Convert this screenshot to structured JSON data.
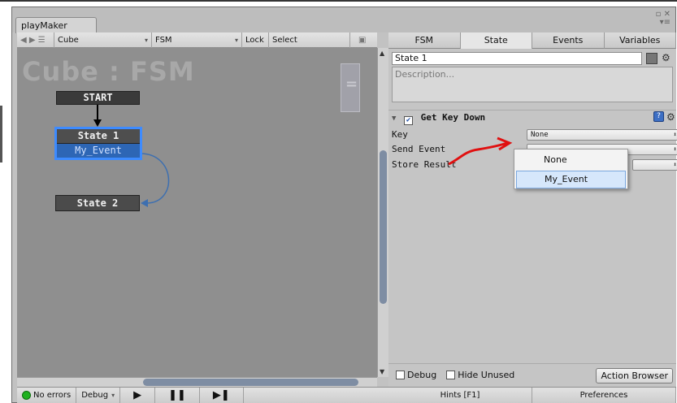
{
  "window": {
    "title": "playMaker",
    "controls": "▫ ✕"
  },
  "toolbar": {
    "object": "Cube",
    "fsm": "FSM",
    "lock": "Lock",
    "select": "Select"
  },
  "canvas": {
    "title": "Cube : FSM",
    "nodes": {
      "start": "START",
      "state1": "State 1",
      "state1_event": "My_Event",
      "state2": "State 2"
    }
  },
  "statusbar": {
    "errors": "No errors",
    "debug": "Debug",
    "play": "▶",
    "pause": "❚❚",
    "step": "▶❚"
  },
  "inspector": {
    "tabs": [
      "FSM",
      "State",
      "Events",
      "Variables"
    ],
    "active_tab": "State",
    "state_name": "State 1",
    "description_placeholder": "Description...",
    "action": {
      "name": "Get Key Down",
      "params": [
        {
          "label": "Key",
          "value": "None"
        },
        {
          "label": "Send Event",
          "value": ""
        },
        {
          "label": "Store Result",
          "value": ""
        }
      ]
    },
    "dropdown_options": [
      "None",
      "My_Event"
    ],
    "highlighted_option": "My_Event",
    "debug_label": "Debug",
    "hide_unused_label": "Hide Unused",
    "action_browser": "Action Browser",
    "hints": "Hints [F1]",
    "preferences": "Preferences"
  },
  "colors": {
    "selection": "#3d8bff",
    "event": "#2d66b5",
    "annotation": "#e01010"
  }
}
